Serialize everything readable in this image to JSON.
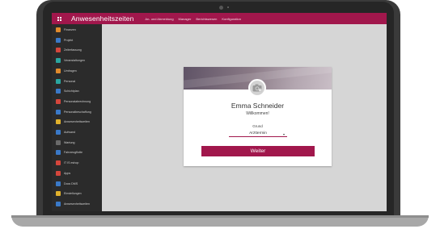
{
  "app": {
    "title": "Anwesenheitszeiten",
    "accent_color": "#a1174c"
  },
  "menu": [
    {
      "label": "An- und Abmeldung"
    },
    {
      "label": "Manager"
    },
    {
      "label": "Berichtswesen"
    },
    {
      "label": "Konfiguration"
    }
  ],
  "sidebar": {
    "items": [
      {
        "label": "Finanzen",
        "color": "#e08a2c"
      },
      {
        "label": "Projekt",
        "color": "#3a79c8"
      },
      {
        "label": "Zeiterfassung",
        "color": "#d4463c"
      },
      {
        "label": "Veranstaltungen",
        "color": "#2aa6a0"
      },
      {
        "label": "Umfragen",
        "color": "#e08a2c"
      },
      {
        "label": "Personal",
        "color": "#2aa6a0"
      },
      {
        "label": "Schichtplan",
        "color": "#3a79c8"
      },
      {
        "label": "Personalabrechnung",
        "color": "#d4463c"
      },
      {
        "label": "Personalbeschaffung",
        "color": "#3a79c8"
      },
      {
        "label": "Anwesenheitszeiten",
        "color": "#e0b12c"
      },
      {
        "label": "Aufwand",
        "color": "#3a79c8"
      },
      {
        "label": "Wartung",
        "color": "#6a6a6a"
      },
      {
        "label": "Fahrzeugflotte",
        "color": "#3a79c8"
      },
      {
        "label": "IT IS eshop",
        "color": "#d4463c"
      },
      {
        "label": "Apps",
        "color": "#d4463c"
      },
      {
        "label": "Docs DMS",
        "color": "#3a79c8"
      },
      {
        "label": "Einstellungen",
        "color": "#e0b12c"
      },
      {
        "label": "Anwesenheitszeiten",
        "color": "#3a79c8"
      }
    ]
  },
  "card": {
    "name": "Emma Schneider",
    "welcome": "Willkommen!",
    "grund_label": "Grund",
    "grund_value": "Arzttermin",
    "button_label": "Weiter"
  }
}
